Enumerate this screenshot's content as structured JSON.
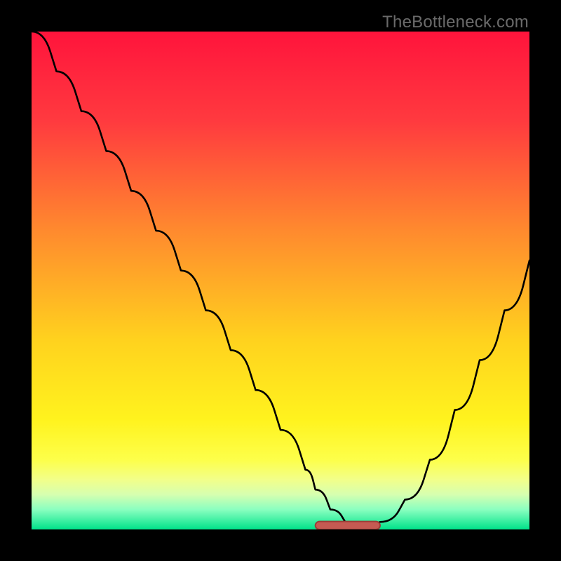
{
  "watermark": "TheBottleneck.com",
  "colors": {
    "gradient_stops": [
      {
        "pct": 0,
        "color": "#ff143c"
      },
      {
        "pct": 18,
        "color": "#ff3a3f"
      },
      {
        "pct": 40,
        "color": "#ff8a2e"
      },
      {
        "pct": 62,
        "color": "#ffd21e"
      },
      {
        "pct": 78,
        "color": "#fff31e"
      },
      {
        "pct": 86,
        "color": "#fdff4a"
      },
      {
        "pct": 90,
        "color": "#f2ff8a"
      },
      {
        "pct": 93,
        "color": "#d6ffb0"
      },
      {
        "pct": 96,
        "color": "#8affc0"
      },
      {
        "pct": 100,
        "color": "#00e28a"
      }
    ],
    "curve_stroke": "#000000",
    "marker_fill": "#c55a52",
    "marker_stroke": "#9b3e38",
    "frame_bg": "#000000",
    "watermark_fg": "#6a6a6a"
  },
  "chart_data": {
    "type": "line",
    "title": "",
    "xlabel": "",
    "ylabel": "",
    "xlim": [
      0,
      100
    ],
    "ylim": [
      0,
      100
    ],
    "grid": false,
    "legend": false,
    "series": [
      {
        "name": "bottleneck-curve",
        "x": [
          0,
          5,
          10,
          15,
          20,
          25,
          30,
          35,
          40,
          45,
          50,
          55,
          57,
          60,
          63,
          65,
          68,
          70,
          75,
          80,
          85,
          90,
          95,
          100
        ],
        "y": [
          100,
          92,
          84,
          76,
          68,
          60,
          52,
          44,
          36,
          28,
          20,
          12,
          8,
          4,
          1.5,
          1,
          1,
          1.5,
          6,
          14,
          24,
          34,
          44,
          54
        ]
      }
    ],
    "markers": [
      {
        "name": "minimum-plateau",
        "shape": "rounded-bar",
        "x_start": 57,
        "x_end": 70,
        "y": 0.8,
        "height": 1.6
      }
    ],
    "notes": "The chart shows a V-shaped curve with a flat minimum plateau around x≈57–70 near y≈0; the rising right arm curves slightly concave. Background is a vertical heat gradient from red (top, worst) through orange/yellow to green (bottom, best). Axes are implied by the black frame; no tick labels or axis titles are shown."
  }
}
